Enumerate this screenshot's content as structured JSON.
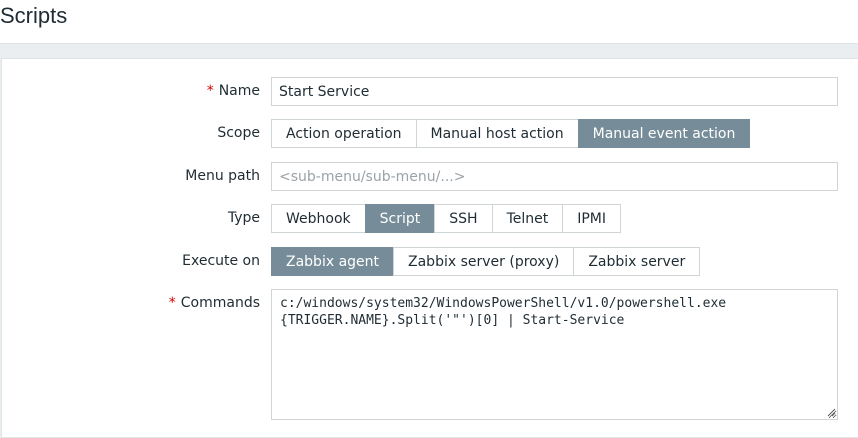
{
  "page": {
    "title": "Scripts"
  },
  "form": {
    "name": {
      "label": "Name",
      "required": "*",
      "value": "Start Service"
    },
    "scope": {
      "label": "Scope",
      "options": [
        "Action operation",
        "Manual host action",
        "Manual event action"
      ],
      "selected": "Manual event action"
    },
    "menu_path": {
      "label": "Menu path",
      "value": "",
      "placeholder": "<sub-menu/sub-menu/...>"
    },
    "type": {
      "label": "Type",
      "options": [
        "Webhook",
        "Script",
        "SSH",
        "Telnet",
        "IPMI"
      ],
      "selected": "Script"
    },
    "execute_on": {
      "label": "Execute on",
      "options": [
        "Zabbix agent",
        "Zabbix server (proxy)",
        "Zabbix server"
      ],
      "selected": "Zabbix agent"
    },
    "commands": {
      "label": "Commands",
      "required": "*",
      "value": "c:/windows/system32/WindowsPowerShell/v1.0/powershell.exe\n{TRIGGER.NAME}.Split('\"')[0] | Start-Service"
    }
  },
  "colors": {
    "accent": "#768d99",
    "required": "#d40000",
    "border": "#cfd4d6"
  },
  "icons": {
    "resize_grip": "resize-grip-icon"
  }
}
